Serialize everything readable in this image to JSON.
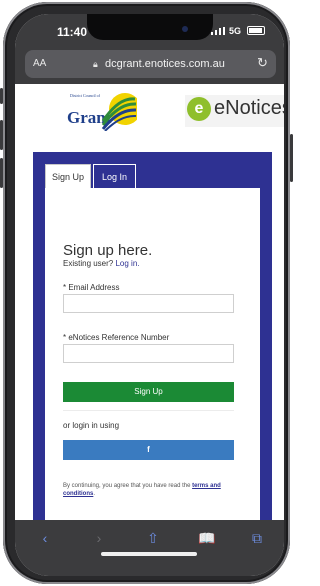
{
  "status_bar": {
    "time": "11:40",
    "network": "5G"
  },
  "browser": {
    "text_size": "AA",
    "lock_icon": "lock-icon",
    "url": "dcgrant.enotices.com.au",
    "reload_icon": "reload-icon"
  },
  "header": {
    "council_line": "District Council of",
    "council_name": "Grant",
    "enotices_mark": "e",
    "enotices_name": "eNotices"
  },
  "tabs": [
    {
      "label": "Sign Up"
    },
    {
      "label": "Log In"
    }
  ],
  "form": {
    "heading": "Sign up here.",
    "existing_prefix": "Existing user?",
    "existing_link": "Log in.",
    "email_label": "* Email Address",
    "email_value": "",
    "reference_label": "* eNotices Reference Number",
    "reference_value": "",
    "signup_button": "Sign Up",
    "or_login": "or login in using",
    "facebook_button": "f",
    "terms_prefix": "By continuing, you agree that you have read the",
    "terms_link": "terms and conditions",
    "terms_suffix": "."
  },
  "toolbar": {
    "back": "‹",
    "forward": "›",
    "share": "⇧",
    "bookmarks": "📖",
    "tabs": "⧉"
  },
  "colors": {
    "panel": "#2e3192",
    "signup_button": "#1b8a35",
    "facebook_button": "#3a7bc0",
    "browser_chrome": "#3c3c3e"
  }
}
